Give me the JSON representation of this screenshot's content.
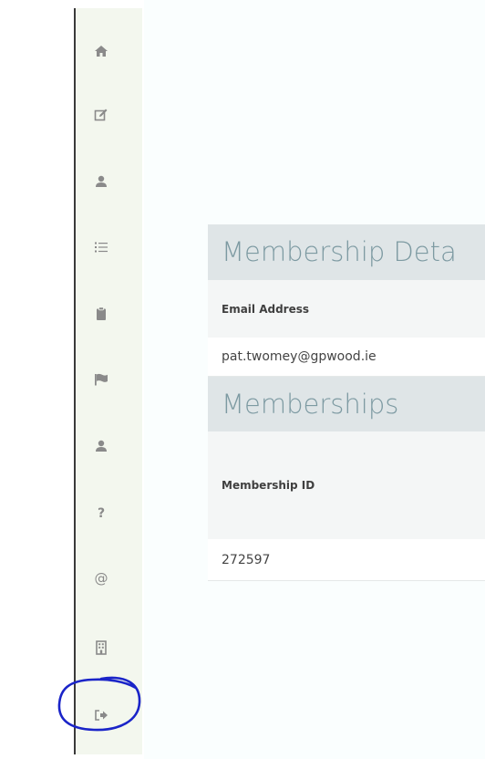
{
  "sidebar": {
    "items": [
      {
        "id": "home",
        "icon": "home-icon"
      },
      {
        "id": "edit",
        "icon": "edit-icon"
      },
      {
        "id": "profile",
        "icon": "user-icon"
      },
      {
        "id": "list",
        "icon": "list-icon"
      },
      {
        "id": "clipboard",
        "icon": "clipboard-icon"
      },
      {
        "id": "flag",
        "icon": "flag-icon"
      },
      {
        "id": "account",
        "icon": "user-icon"
      },
      {
        "id": "help",
        "icon": "question-icon"
      },
      {
        "id": "contact",
        "icon": "at-icon"
      },
      {
        "id": "building",
        "icon": "building-icon"
      },
      {
        "id": "logout",
        "icon": "sign-out-icon"
      }
    ],
    "help_glyph": "?",
    "at_glyph": "@",
    "icon_color": "#8a8a8a"
  },
  "membership_details": {
    "title": "Membership Deta",
    "email_label": "Email Address",
    "email_value": "pat.twomey@gpwood.ie"
  },
  "memberships": {
    "title": "Memberships",
    "id_label": "Membership ID",
    "id_value": "272597"
  },
  "annotation": {
    "color": "#1a24c8"
  }
}
